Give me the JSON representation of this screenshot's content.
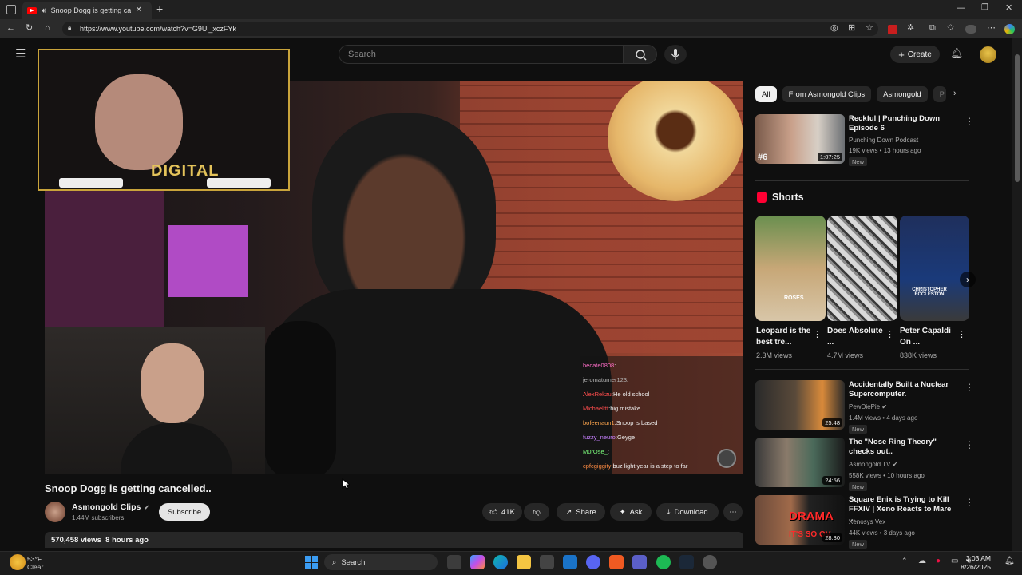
{
  "browser": {
    "tab_title": "Snoop Dogg is getting cancelled..",
    "url": "https://www.youtube.com/watch?v=G9Ui_xczFYk"
  },
  "header": {
    "search_placeholder": "Search",
    "create_label": "Create"
  },
  "video": {
    "title": "Snoop Dogg is getting cancelled..",
    "channel": "Asmongold Clips",
    "subscribers": "1.44M subscribers",
    "subscribe_label": "Subscribe",
    "likes": "41K",
    "share_label": "Share",
    "ask_label": "Ask",
    "download_label": "Download",
    "views": "570,458 views",
    "age": "8 hours ago",
    "overlay_text": "DIGITAL"
  },
  "chat": [
    {
      "user": "hecate0808",
      "msg": "",
      "color": "#ff6ec7"
    },
    {
      "user": "jeromaturner123",
      "msg": "",
      "color": "#b3b3b3"
    },
    {
      "user": "AlexRekzu",
      "msg": "He old school",
      "color": "#ff4d4d"
    },
    {
      "user": "Michaelttt",
      "msg": "big mistake",
      "color": "#ff4d4d"
    },
    {
      "user": "bofeenaun1",
      "msg": "Snoop is based",
      "color": "#ffa64d"
    },
    {
      "user": "fuzzy_neuro",
      "msg": "Geyge",
      "color": "#c780ff"
    },
    {
      "user": "M0rOse_",
      "msg": "",
      "color": "#7dff7d"
    },
    {
      "user": "cpfcgiggity",
      "msg": "buz light year is a step to far",
      "color": "#ff8c42"
    }
  ],
  "sidebar": {
    "chips": [
      "All",
      "From Asmongold Clips",
      "Asmongold",
      "P"
    ],
    "top_rec": {
      "title": "Reckful | Punching Down Episode 6",
      "channel": "Punching Down Podcast",
      "meta": "19K views • 13 hours ago",
      "badge": "New",
      "duration": "1:07:25",
      "rank": "#6"
    },
    "shorts_heading": "Shorts",
    "shorts": [
      {
        "title": "Leopard is the best tre...",
        "views": "2.3M views"
      },
      {
        "title": "Does Absolute ...",
        "views": "4.7M views"
      },
      {
        "title": "Peter Capaldi On ...",
        "views": "838K views"
      }
    ],
    "recs": [
      {
        "title": "Accidentally Built a Nuclear Supercomputer.",
        "channel": "PewDiePie",
        "meta": "1.4M views • 4 days ago",
        "badge": "New",
        "duration": "25:48"
      },
      {
        "title": "The \"Nose Ring Theory\" checks out..",
        "channel": "Asmongold TV",
        "meta": "558K views • 10 hours ago",
        "badge": "New",
        "duration": "24:56"
      },
      {
        "title": "Square Enix is Trying to Kill FFXIV | Xeno Reacts to Mare ...",
        "channel": "Xenosys Vex",
        "meta": "44K views • 3 days ago",
        "badge": "New",
        "duration": "28:30"
      }
    ],
    "thumb_text": {
      "drama": "DRAMA",
      "so": "IT'S SO OV",
      "roses": "ROSES",
      "doctor": "CHRISTOPHER ECCLESTON"
    }
  },
  "taskbar": {
    "weather_temp": "53°F",
    "weather_desc": "Clear",
    "search_label": "Search",
    "time": "3:03 AM",
    "date": "8/26/2025"
  }
}
